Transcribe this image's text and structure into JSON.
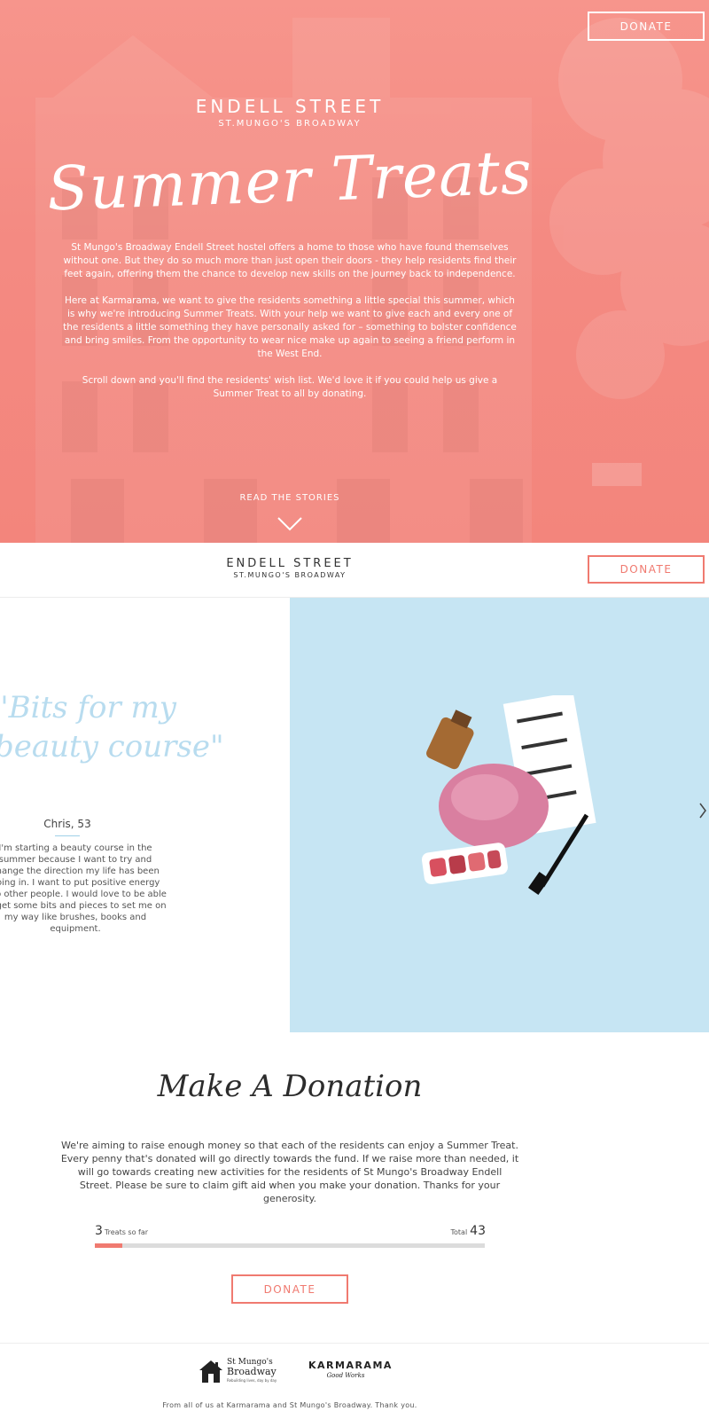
{
  "hero": {
    "donate_label": "DONATE",
    "brand_title": "ENDELL STREET",
    "brand_subtitle": "ST.MUNGO'S BROADWAY",
    "headline": "Summer Treats",
    "paragraphs": [
      "St Mungo's Broadway Endell Street hostel offers a home to those who have found themselves without one. But they do so much more than just open their doors - they help residents find their feet again, offering them the chance to develop new skills on the journey back to independence.",
      "Here at Karmarama, we want to give the residents something a little special this summer, which is why we're introducing Summer Treats. With your help we want to give each and every one of the residents a little something they have personally asked for – something to bolster confidence and bring smiles. From the opportunity to wear nice make up again to seeing a friend perform in the West End.",
      "Scroll down and you'll find the residents' wish list. We'd love it if you could help us give a Summer Treat to all by donating."
    ],
    "read_stories_label": "READ THE STORIES",
    "background_color": "#f48a82"
  },
  "header": {
    "brand_title": "ENDELL STREET",
    "brand_subtitle": "ST.MUNGO'S BROADWAY",
    "donate_label": "DONATE",
    "accent_color": "#f07a70"
  },
  "story": {
    "quote": "\"Bits for my beauty course\"",
    "quote_line1": "\"Bits for my",
    "quote_line2": "beauty course\"",
    "person": "Chris, 53",
    "text": "I'm starting a beauty course in the summer because I want to try and change the direction my life has been going in. I want to put positive energy into other people. I would love to be able to get some bits and pieces to set me on my way like brushes, books and equipment.",
    "image_bg_color": "#c6e5f3"
  },
  "donation": {
    "title": "Make A Donation",
    "text": "We're aiming to raise enough money so that each of the residents can enjoy a Summer Treat. Every penny that's donated will go directly towards the fund. If we raise more than needed, it will go towards creating new activities for the residents of St Mungo's Broadway Endell Street. Please be sure to claim gift aid when you make your donation. Thanks for your generosity.",
    "treats_count": "3",
    "treats_label": "Treats so far",
    "total_label": "Total",
    "total_count": "43",
    "progress_fraction": 0.0698,
    "donate_label": "DONATE"
  },
  "footer": {
    "mungo_line1": "St Mungo's",
    "mungo_line2": "Broadway",
    "mungo_tagline": "Rebuilding lives, day by day",
    "karmarama_title": "KARMARAMA",
    "karmarama_subtitle": "Good Works",
    "thanks_text": "From all of us at Karmarama and St Mungo's Broadway. Thank you."
  }
}
